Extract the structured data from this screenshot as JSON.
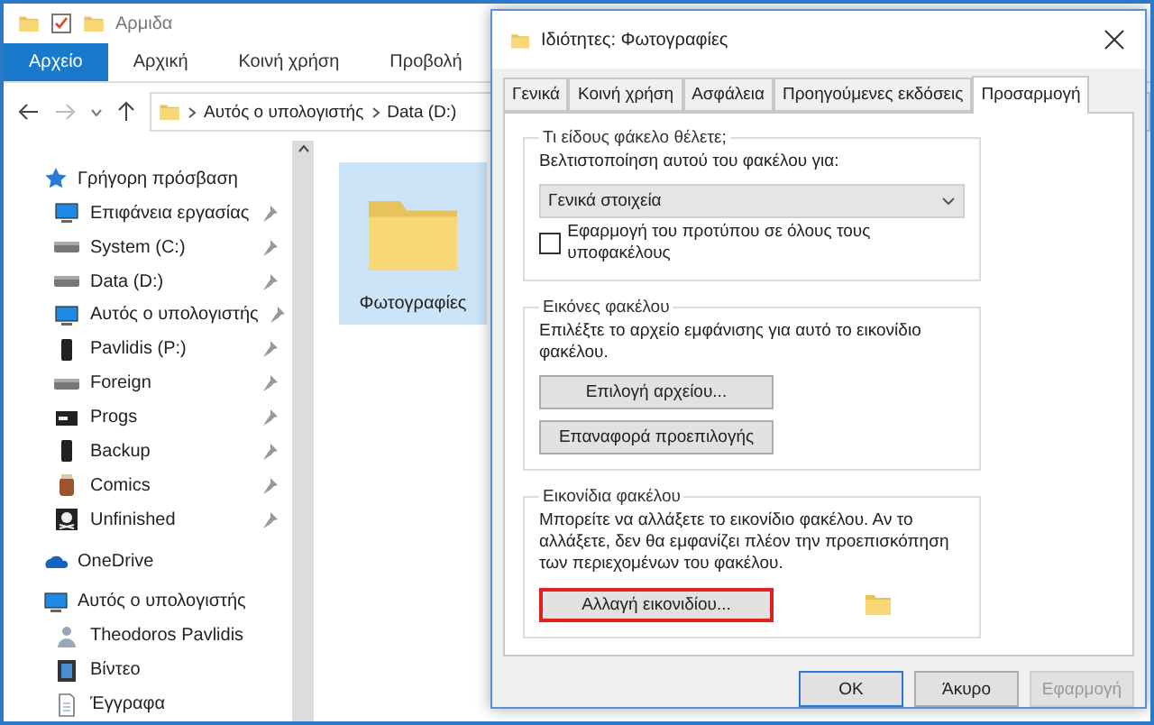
{
  "window": {
    "title": "Αρμιδα"
  },
  "ribbon_tabs": [
    {
      "label": "Αρχείο",
      "selected": true
    },
    {
      "label": "Αρχική",
      "selected": false
    },
    {
      "label": "Κοινή χρήση",
      "selected": false
    },
    {
      "label": "Προβολή",
      "selected": false
    }
  ],
  "breadcrumb": [
    "Αυτός ο υπολογιστής",
    "Data (D:)"
  ],
  "sidebar": [
    {
      "label": "Γρήγορη πρόσβαση",
      "kind": "star",
      "children": [
        {
          "label": "Επιφάνεια εργασίας",
          "kind": "monitor",
          "pinned": true
        },
        {
          "label": "System (C:)",
          "kind": "drive",
          "pinned": true
        },
        {
          "label": "Data (D:)",
          "kind": "drive",
          "pinned": true
        },
        {
          "label": "Αυτός ο υπολογιστής",
          "kind": "monitor",
          "pinned": true
        },
        {
          "label": "Pavlidis (P:)",
          "kind": "phone",
          "pinned": true
        },
        {
          "label": "Foreign",
          "kind": "drive",
          "pinned": true
        },
        {
          "label": "Progs",
          "kind": "console",
          "pinned": true
        },
        {
          "label": "Backup",
          "kind": "phone",
          "pinned": true
        },
        {
          "label": "Comics",
          "kind": "jar",
          "pinned": true
        },
        {
          "label": "Unfinished",
          "kind": "skull",
          "pinned": true
        }
      ]
    },
    {
      "label": "OneDrive",
      "kind": "cloud"
    },
    {
      "label": "Αυτός ο υπολογιστής",
      "kind": "monitor",
      "children": [
        {
          "label": "Theodoros Pavlidis",
          "kind": "person"
        },
        {
          "label": "Βίντεο",
          "kind": "film"
        },
        {
          "label": "Έγγραφα",
          "kind": "document"
        }
      ]
    }
  ],
  "files": [
    {
      "label": "Φωτογραφίες",
      "selected": true
    }
  ],
  "dialog": {
    "title": "Ιδιότητες: Φωτογραφίες",
    "tabs": [
      {
        "label": "Γενικά",
        "selected": false
      },
      {
        "label": "Κοινή χρήση",
        "selected": false
      },
      {
        "label": "Ασφάλεια",
        "selected": false
      },
      {
        "label": "Προηγούμενες εκδόσεις",
        "selected": false
      },
      {
        "label": "Προσαρμογή",
        "selected": true
      }
    ],
    "folder_type": {
      "legend": "Τι είδους φάκελο θέλετε;",
      "label": "Βελτιστοποίηση αυτού του φακέλου για:",
      "value": "Γενικά στοιχεία",
      "checkbox": {
        "label": "Εφαρμογή του προτύπου σε όλους τους υποφακέλους",
        "checked": false
      }
    },
    "folder_pictures": {
      "legend": "Εικόνες φακέλου",
      "text": "Επιλέξτε το αρχείο εμφάνισης για αυτό το εικονίδιο φακέλου.",
      "buttons": [
        {
          "label": "Επιλογή αρχείου...",
          "highlighted": false
        },
        {
          "label": "Επαναφορά προεπιλογής",
          "highlighted": false
        }
      ]
    },
    "folder_icons": {
      "legend": "Εικονίδια φακέλου",
      "text": "Μπορείτε να αλλάξετε το εικονίδιο φακέλου. Αν το αλλάξετε, δεν θα εμφανίζει πλέον την προεπισκόπηση των περιεχομένων του φακέλου.",
      "buttons": [
        {
          "label": "Αλλαγή εικονιδίου...",
          "highlighted": true
        }
      ]
    },
    "buttons": [
      {
        "label": "OK",
        "disabled": false,
        "default": true
      },
      {
        "label": "Άκυρο",
        "disabled": false,
        "default": false
      },
      {
        "label": "Εφαρμογή",
        "disabled": true,
        "default": false
      }
    ]
  }
}
